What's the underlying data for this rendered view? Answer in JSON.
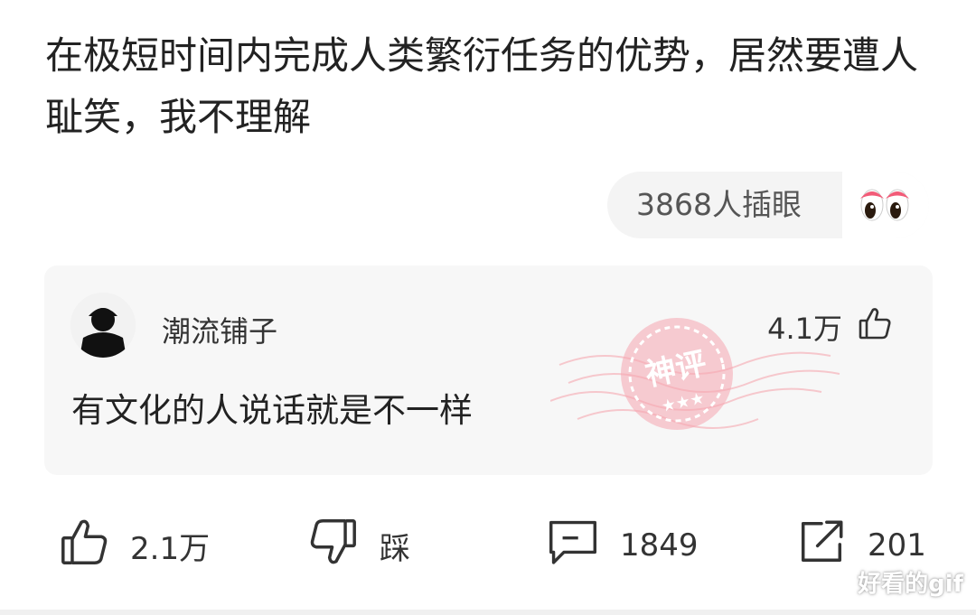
{
  "post": {
    "title": "在极短时间内完成人类繁衍任务的优势，居然要遭人耻笑，我不理解"
  },
  "peek": {
    "count_label": "3868人插眼",
    "icon": "eyes-icon"
  },
  "comment": {
    "username": "潮流铺子",
    "text": "有文化的人说话就是不一样",
    "likes": "4.1万",
    "badge": {
      "label": "神评",
      "stars": "★★★",
      "color": "#f27a87"
    }
  },
  "actions": {
    "like_count": "2.1万",
    "dislike_label": "踩",
    "comment_count": "1849",
    "share_count": "201"
  },
  "watermark": "好看的gif",
  "colors": {
    "background": "#ffffff",
    "card": "#f7f7f7",
    "badge_pink": "#f27a87",
    "eye_pink": "#f25b78"
  }
}
